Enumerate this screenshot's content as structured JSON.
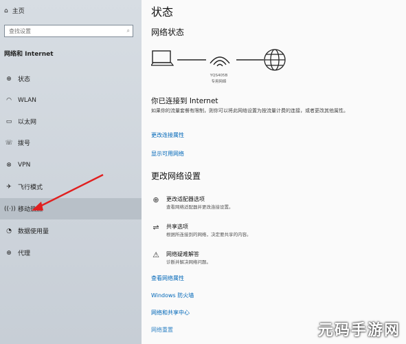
{
  "sidebar": {
    "home": "主页",
    "search_placeholder": "查找设置",
    "section": "网络和 Internet",
    "items": [
      {
        "icon": "status-icon",
        "label": "状态"
      },
      {
        "icon": "wifi-icon",
        "label": "WLAN"
      },
      {
        "icon": "ethernet-icon",
        "label": "以太网"
      },
      {
        "icon": "dialup-icon",
        "label": "拨号"
      },
      {
        "icon": "vpn-icon",
        "label": "VPN"
      },
      {
        "icon": "airplane-icon",
        "label": "飞行模式"
      },
      {
        "icon": "hotspot-icon",
        "label": "移动热点"
      },
      {
        "icon": "data-usage-icon",
        "label": "数据使用量"
      },
      {
        "icon": "proxy-icon",
        "label": "代理"
      }
    ]
  },
  "main": {
    "title": "状态",
    "network_status": "网络状态",
    "network_name": "YQS405B",
    "network_type": "专用网络",
    "connected": "你已连接到 Internet",
    "desc": "如果你的流量套餐有限制，则你可以将此网络设置为按流量计费的连接，或者更改其他属性。",
    "link_change_props": "更改连接属性",
    "link_show_networks": "显示可用网络",
    "change_settings": "更改网络设置",
    "options": [
      {
        "title": "更改适配器选项",
        "desc": "查看网络适配器并更改连接设置。"
      },
      {
        "title": "共享选项",
        "desc": "根据所连接到的网络，决定要共享的内容。"
      },
      {
        "title": "网络疑难解答",
        "desc": "诊断并解决网络问题。"
      }
    ],
    "links": [
      "查看网络属性",
      "Windows 防火墙",
      "网络和共享中心",
      "网络重置"
    ]
  },
  "watermark": "元码手游网"
}
